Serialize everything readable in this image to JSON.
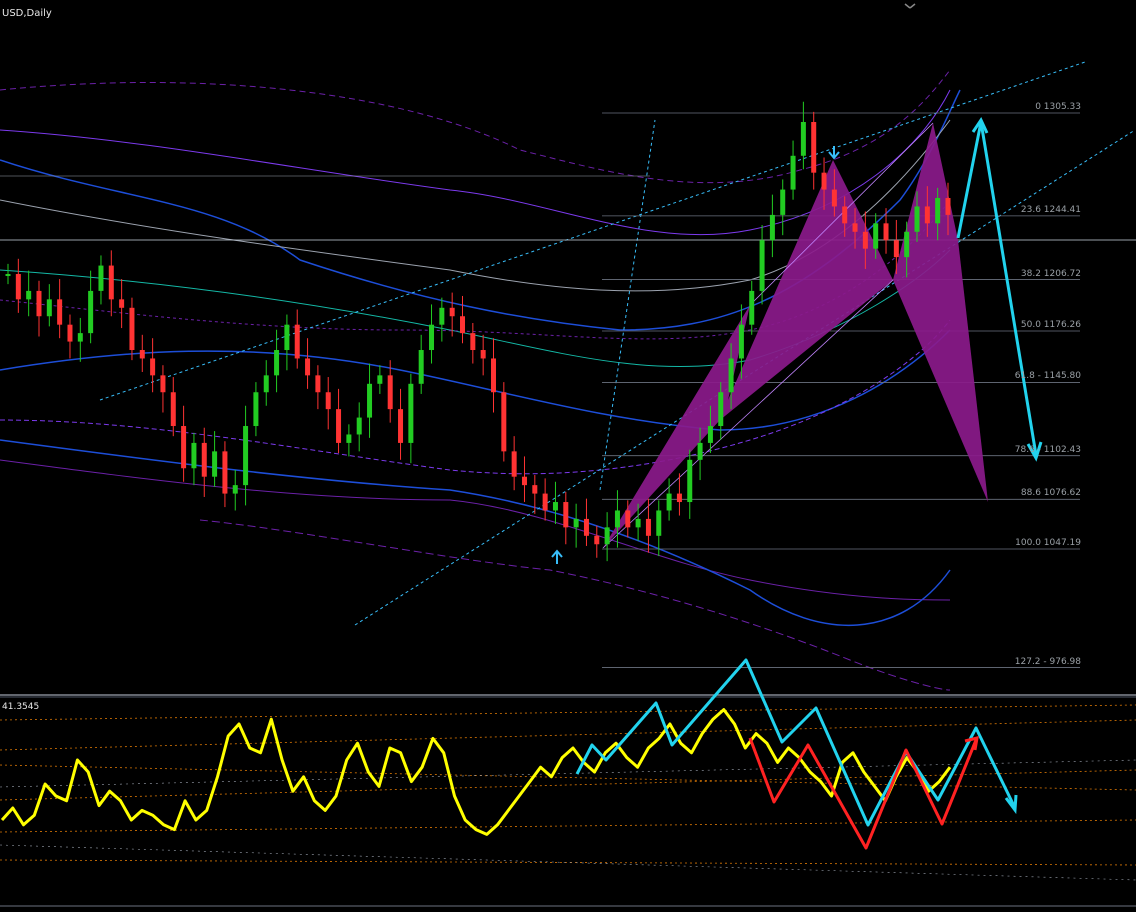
{
  "header": {
    "symbol": "USD,Daily",
    "osc_value": "41.3545"
  },
  "colors": {
    "background": "#000000",
    "bull_candle": "#22cc22",
    "bear_candle": "#ff3333",
    "pattern_fill": "#8b1a8b",
    "projection": "#22d3ee",
    "oscillator": "#ffff00",
    "osc_down": "#ff2222",
    "fib_line": "#6b7280"
  },
  "chart_data": [
    {
      "type": "candlestick",
      "title": "USD,Daily",
      "fib_levels": [
        {
          "label": "0 1305.33",
          "value": 1305.33
        },
        {
          "label": "23.6 1244.41",
          "value": 1244.41
        },
        {
          "label": "38.2 1206.72",
          "value": 1206.72
        },
        {
          "label": "50.0 1176.26",
          "value": 1176.26
        },
        {
          "label": "61.8 - 1145.80",
          "value": 1145.8
        },
        {
          "label": "78.6 - 1102.43",
          "value": 1102.43
        },
        {
          "label": "88.6 1076.62",
          "value": 1076.62
        },
        {
          "label": "100.0 1047.19",
          "value": 1047.19
        },
        {
          "label": "127.2 - 976.98",
          "value": 976.98
        }
      ],
      "series": [
        {
          "values": [
            1210,
            1195,
            1200,
            1185,
            1195,
            1180,
            1170,
            1175,
            1200,
            1215,
            1195,
            1190,
            1165,
            1160,
            1150,
            1140,
            1120,
            1095,
            1110,
            1090,
            1105,
            1080,
            1085,
            1120,
            1140,
            1150,
            1165,
            1180,
            1160,
            1150,
            1140,
            1130,
            1110,
            1115,
            1125,
            1145,
            1150,
            1130,
            1110,
            1145,
            1165,
            1180,
            1190,
            1185,
            1175,
            1165,
            1160,
            1140,
            1105,
            1090,
            1085,
            1080,
            1070,
            1075,
            1060,
            1065,
            1055,
            1050,
            1060,
            1070,
            1060,
            1065,
            1055,
            1070,
            1080,
            1075,
            1100,
            1110,
            1120,
            1140,
            1160,
            1180,
            1200,
            1230,
            1245,
            1260,
            1280,
            1300,
            1270,
            1260,
            1250,
            1240,
            1235,
            1225,
            1240,
            1230,
            1220,
            1235,
            1250,
            1240,
            1255,
            1245
          ]
        }
      ]
    },
    {
      "type": "line",
      "title": "41.3545",
      "series": [
        {
          "values": [
            30,
            35,
            28,
            32,
            45,
            40,
            38,
            55,
            50,
            36,
            42,
            38,
            30,
            34,
            32,
            28,
            26,
            38,
            30,
            34,
            48,
            65,
            70,
            60,
            58,
            72,
            55,
            42,
            48,
            38,
            34,
            40,
            55,
            62,
            50,
            44,
            60,
            58,
            46,
            52,
            64,
            58,
            40,
            30,
            26,
            24,
            28,
            34,
            40,
            46,
            52,
            48,
            56,
            60,
            54,
            50,
            58,
            62,
            56,
            52,
            60,
            64,
            70,
            62,
            58,
            66,
            72,
            76,
            70,
            60,
            66,
            62,
            54,
            60,
            56,
            50,
            46,
            40,
            54,
            58,
            50,
            44,
            38,
            48,
            56,
            50,
            42,
            46,
            52
          ]
        }
      ]
    }
  ]
}
